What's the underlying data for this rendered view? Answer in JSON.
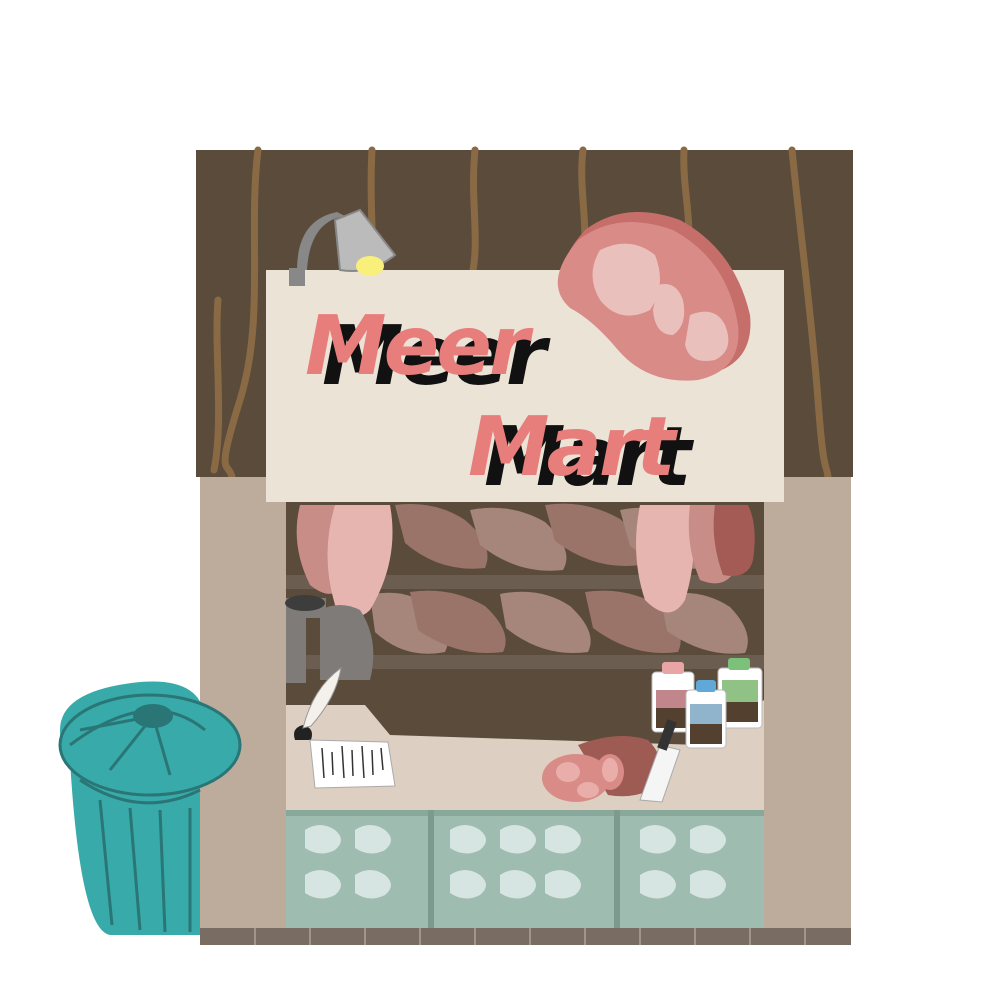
{
  "sign": {
    "line1": "Meer",
    "line2": "Mart"
  },
  "colors": {
    "roof": "#5a4b3b",
    "roof_stripe": "#8a6a45",
    "wall": "#bdac9c",
    "sign_bg": "#ebe3d6",
    "sign_text": "#e87e7c",
    "sign_shadow": "#111111",
    "interior_dark": "#5a4b3b",
    "shelf": "#6b5d50",
    "counter": "#ddd0c2",
    "glass": "#9ebcb0",
    "trash_can": "#38aaa9",
    "trash_can_dark": "#2a7676",
    "base": "#786c63"
  },
  "icons": [
    "desk-lamp-icon",
    "steak-icon",
    "hanging-meat-icon",
    "trash-can-icon",
    "quill-inkwell-icon",
    "receipt-note-icon",
    "spice-jar-icon",
    "cleaver-icon",
    "ham-icon"
  ]
}
